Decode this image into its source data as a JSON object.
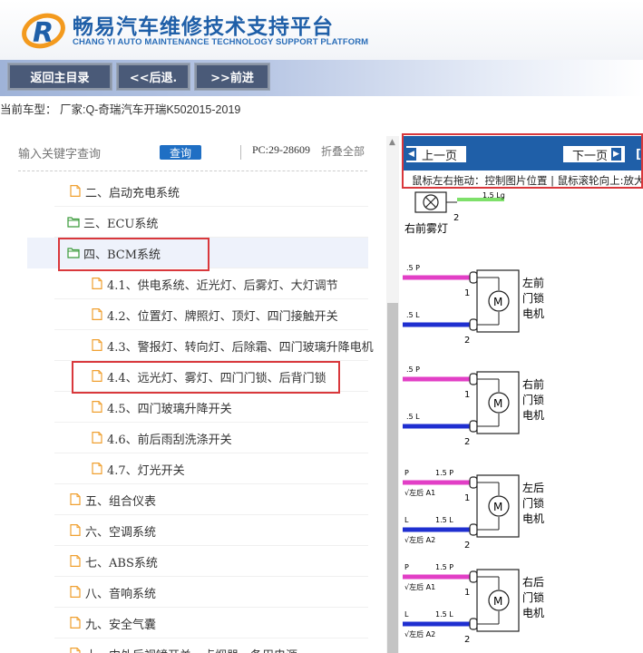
{
  "header": {
    "title": "畅易汽车维修技术支持平台",
    "subtitle": "CHANG YI AUTO MAINTENANCE TECHNOLOGY SUPPORT PLATFORM"
  },
  "toolbar": {
    "home_label": "返回主目录",
    "back_label": "<<后退.",
    "forward_label": ">>前进"
  },
  "current_model": "当前车型： 厂家:Q-奇瑞汽车开瑞K502015-2019",
  "search": {
    "placeholder": "输入关键字查询",
    "button_label": "查询",
    "pc_code": "PC:29-28609",
    "collapse_label": "折叠全部"
  },
  "tree": [
    {
      "label": "二、启动充电系统",
      "type": "closed"
    },
    {
      "label": "三、ECU系统",
      "type": "open"
    },
    {
      "label": "四、BCM系统",
      "type": "open"
    },
    {
      "label": "4.1、供电系统、近光灯、后雾灯、大灯调节",
      "type": "doc"
    },
    {
      "label": "4.2、位置灯、牌照灯、顶灯、四门接触开关",
      "type": "doc"
    },
    {
      "label": "4.3、警报灯、转向灯、后除霜、四门玻璃升降电机",
      "type": "doc"
    },
    {
      "label": "4.4、远光灯、雾灯、四门门锁、后背门锁",
      "type": "doc"
    },
    {
      "label": "4.5、四门玻璃升降开关",
      "type": "doc"
    },
    {
      "label": "4.6、前后雨刮洗涤开关",
      "type": "doc"
    },
    {
      "label": "4.7、灯光开关",
      "type": "doc"
    },
    {
      "label": "五、组合仪表",
      "type": "closed"
    },
    {
      "label": "六、空调系统",
      "type": "closed"
    },
    {
      "label": "七、ABS系统",
      "type": "closed"
    },
    {
      "label": "八、音响系统",
      "type": "closed"
    },
    {
      "label": "九、安全气囊",
      "type": "closed"
    },
    {
      "label": "十、内外后视镜开关、点烟器、备用电源",
      "type": "closed"
    }
  ],
  "viewer": {
    "prev_label": "上一页",
    "next_label": "下一页",
    "bracket": "[",
    "hint": "鼠标左右拖动：控制图片位置 | 鼠标滚轮向上:放大"
  },
  "diagram": {
    "wire_top": "1.5 Lg",
    "lamp_label": "右前雾灯",
    "motors": [
      {
        "label": [
          "左前",
          "门锁",
          "电机"
        ],
        "w1": ".5 P",
        "w2": ".5 L"
      },
      {
        "label": [
          "右前",
          "门锁",
          "电机"
        ],
        "w1": ".5 P",
        "w2": ".5 L"
      },
      {
        "label": [
          "左后",
          "门锁",
          "电机"
        ],
        "w1": "1.5 P",
        "w2": "1.5 L",
        "p1": "P",
        "p2": "L",
        "a1": "√左后 A1",
        "a2": "√左后 A2"
      },
      {
        "label": [
          "右后",
          "门锁",
          "电机"
        ],
        "w1": "1.5 P",
        "w2": "1.5 L",
        "p1": "P",
        "p2": "L",
        "a1": "√左后 A1",
        "a2": "√左后 A2"
      }
    ],
    "pin1": "1",
    "pin2": "2",
    "motor_symbol": "M"
  },
  "colors": {
    "brand_blue": "#1f5fa8",
    "highlight_red": "#d9383c",
    "wire_pink": "#e23fc6",
    "wire_blue": "#1f2fd0",
    "wire_green": "#7ee06a",
    "folder_open": "#3a9a3a",
    "doc_icon": "#f0a030"
  }
}
